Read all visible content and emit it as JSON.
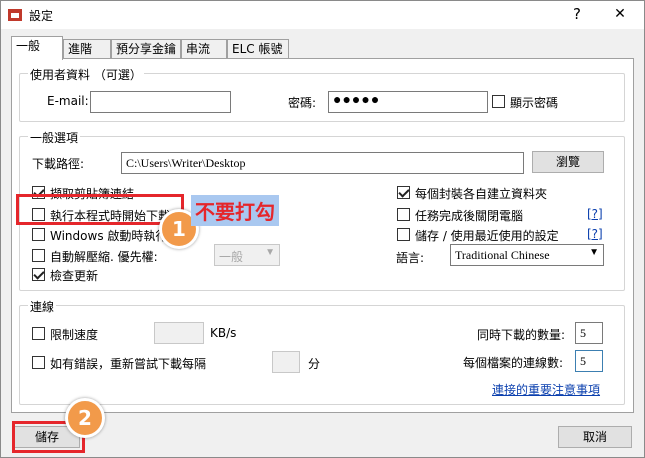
{
  "window": {
    "title": "設定",
    "help": "?",
    "close": "✕"
  },
  "tabs": [
    "一般",
    "進階",
    "預分享金鑰",
    "串流",
    "ELC 帳號"
  ],
  "user_info": {
    "legend": "使用者資料 （可選）",
    "email_label": "E-mail:",
    "email_value": "",
    "password_label": "密碼:",
    "password_value": "●●●●●",
    "show_password": "顯示密碼"
  },
  "general": {
    "legend": "一般選項",
    "download_path_label": "下載路徑:",
    "download_path_value": "C:\\Users\\Writer\\Desktop",
    "browse": "瀏覽",
    "left_options": [
      {
        "label": "擷取剪貼簿連結",
        "checked": true
      },
      {
        "label": "執行本程式時開始下載",
        "checked": false
      },
      {
        "label": "Windows 啟動時執行",
        "checked": false
      },
      {
        "label": "自動解壓縮. 優先權:",
        "checked": false
      },
      {
        "label": "檢查更新",
        "checked": true
      }
    ],
    "priority_value": "一般",
    "right_options": [
      {
        "label": "每個封裝各自建立資料夾",
        "checked": true
      },
      {
        "label": "任務完成後關閉電腦",
        "checked": false,
        "help": "[?]"
      },
      {
        "label": "儲存 / 使用最近使用的設定",
        "checked": false,
        "help": "[?]"
      }
    ],
    "language_label": "語言:",
    "language_value": "Traditional Chinese"
  },
  "connection": {
    "legend": "連線",
    "limit_speed": "限制速度",
    "speed_unit": "KB/s",
    "retry": "如有錯誤，重新嘗試下載每隔",
    "retry_unit": "分",
    "simultaneous_label": "同時下載的數量:",
    "simultaneous_value": "5",
    "per_file_label": "每個檔案的連線數:",
    "per_file_value": "5",
    "notes_link": "連接的重要注意事項"
  },
  "buttons": {
    "save": "儲存",
    "cancel": "取消"
  },
  "annotations": {
    "one": "1",
    "two": "2",
    "note": "不要打勾"
  }
}
